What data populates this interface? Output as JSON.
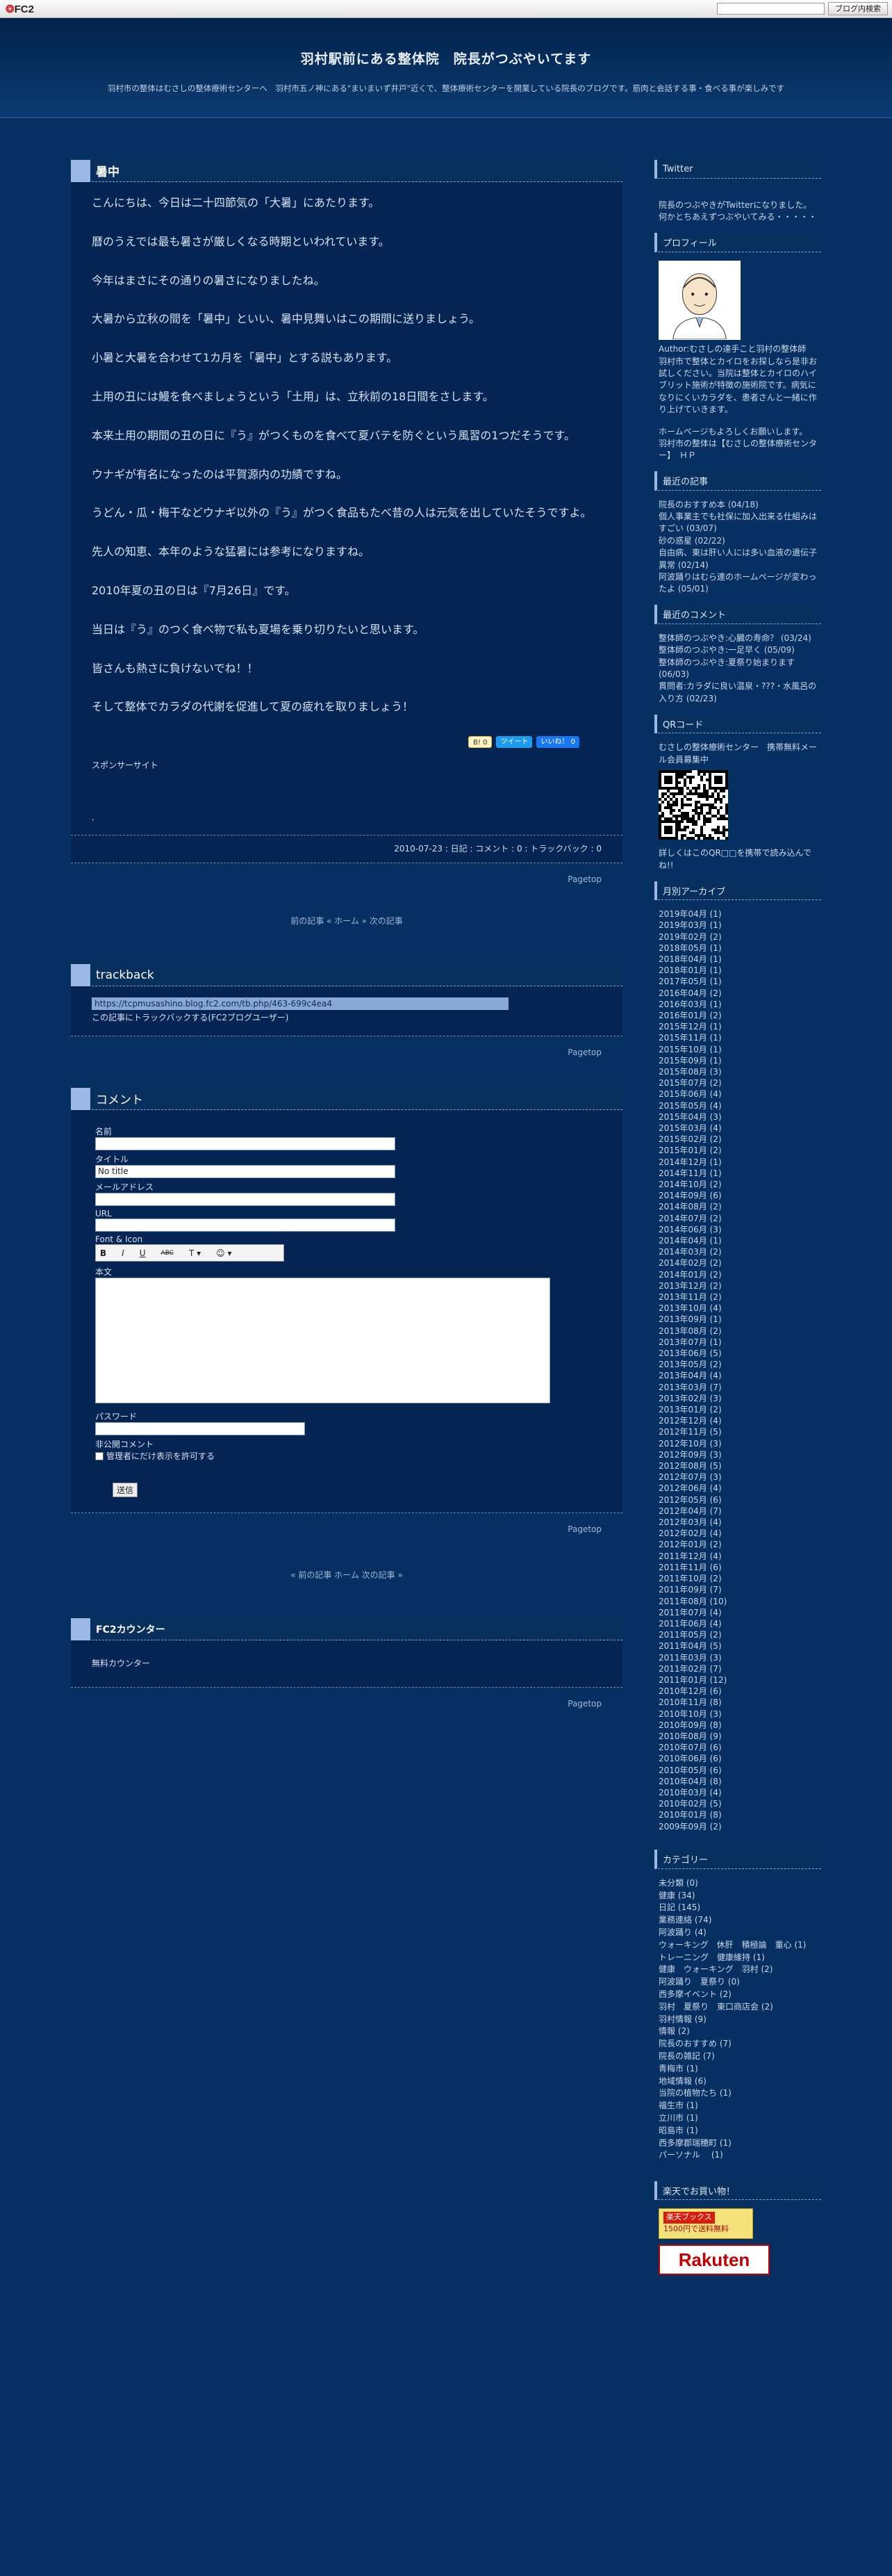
{
  "fc2bar": {
    "logo_a": "FC2",
    "search_button": "ブログ内検索"
  },
  "header": {
    "title": "羽村駅前にある整体院　院長がつぶやいてます",
    "description": "羽村市の整体はむさしの整体療術センターへ　羽村市五ノ神にある\"まいまいず井戸\"近くで、整体療術センターを開業している院長のブログです。筋肉と会話する事・食べる事が楽しみです"
  },
  "entry": {
    "title": "暑中",
    "paragraphs": [
      "こんにちは、今日は二十四節気の「大暑」にあたります。",
      "暦のうえでは最も暑さが厳しくなる時期といわれています。",
      "今年はまさにその通りの暑さになりましたね。",
      "大暑から立秋の間を「暑中」といい、暑中見舞いはこの期間に送りましょう。",
      "小暑と大暑を合わせて1カ月を「暑中」とする説もあります。",
      "土用の丑には鰻を食べましょうという「土用」は、立秋前の18日間をさします。",
      "本来土用の期間の丑の日に『う』がつくものを食べて夏バテを防ぐという風習の1つだそうです。",
      "ウナギが有名になったのは平賀源内の功績ですね。",
      "うどん・瓜・梅干などウナギ以外の『う』がつく食品もたべ昔の人は元気を出していたそうですよ。",
      "先人の知恵、本年のような猛暑には参考になりますね。",
      "2010年夏の丑の日は『7月26日』です。",
      "当日は『う』のつく食べ物で私も夏場を乗り切りたいと思います。",
      "皆さんも熱さに負けないでね！！",
      "そして整体でカラダの代謝を促進して夏の疲れを取りましょう！"
    ],
    "share_hatena": "B! 0",
    "share_tweet": "ツイート",
    "share_like": "いいね！ 0",
    "sponsor": "スポンサーサイト",
    "dot": ".",
    "footer": "2010-07-23 : 日記 : コメント : 0 : トラックバック : 0",
    "pagetop": "Pagetop"
  },
  "nav1": "前の記事 « ホーム » 次の記事",
  "trackback": {
    "title": "trackback",
    "url": "https://tcpmusashino.blog.fc2.com/tb.php/463-699c4ea4",
    "note": "この記事にトラックバックする(FC2ブログユーザー)",
    "pagetop": "Pagetop"
  },
  "comment": {
    "title": "コメント",
    "name_label": "名前",
    "title_label": "タイトル",
    "title_value": "No title",
    "mail_label": "メールアドレス",
    "url_label": "URL",
    "font_label": "Font & Icon",
    "tools": [
      "B",
      "I",
      "U",
      "ABC",
      "T ▾",
      "☺ ▾"
    ],
    "body_label": "本文",
    "pass_label": "パスワード",
    "secret_label": "非公開コメント",
    "secret_option": "管理者にだけ表示を許可する",
    "submit": "送信",
    "pagetop": "Pagetop"
  },
  "nav2": "« 前の記事  ホーム  次の記事 »",
  "counter": {
    "title": "FC2カウンター",
    "body": "無料カウンター",
    "pagetop": "Pagetop"
  },
  "side": {
    "twitter": {
      "title": "Twitter",
      "body": "院長のつぶやきがTwitterになりました。何かとちあえずつぶやいてみる・・・・・"
    },
    "profile": {
      "title": "プロフィール",
      "author": "Author:むさしの達手こと羽村の整体師",
      "body": "羽村市で整体とカイロをお探しなら是非お試しください。当院は整体とカイロのハイブリット施術が特徴の施術院です。病気になりにくいカラダを、患者さんと一緒に作り上げていきます。",
      "hp": "ホームページもよろしくお願いします。",
      "hp2": "羽村市の整体は【むさしの整体療術センター】　ＨＰ"
    },
    "recent": {
      "title": "最近の記事",
      "items": [
        "院長のおすすめ本 (04/18)",
        "個人事業主でも社保に加入出来る仕組みはすごい (03/07)",
        "砂の惑星 (02/22)",
        "自由病、東は肝い人には多い血液の遺伝子異常 (02/14)",
        "阿波踊りはむら連のホームページが変わったよ (05/01)"
      ]
    },
    "comments": {
      "title": "最近のコメント",
      "items": [
        "整体師のつぶやき:心臓の寿命？ (03/24)",
        "整体師のつぶやき:一足早く (05/09)",
        "整体師のつぶやき:夏祭り始まります (06/03)",
        "貫問者:カラダに良い温泉・???・水風呂の入り方 (02/23)"
      ]
    },
    "qr": {
      "title": "QRコード",
      "body": "むさしの整体療術センター　携帯無料メール会員募集中",
      "foot": "詳しくはこのQR□□を携帯で読み込んでね!!"
    },
    "archive": {
      "title": "月別アーカイブ",
      "items": [
        "2019年04月 (1)",
        "2019年03月 (1)",
        "2019年02月 (2)",
        "2018年05月 (1)",
        "2018年04月 (1)",
        "2018年01月 (1)",
        "2017年05月 (1)",
        "2016年04月 (2)",
        "2016年03月 (1)",
        "2016年01月 (2)",
        "2015年12月 (1)",
        "2015年11月 (1)",
        "2015年10月 (1)",
        "2015年09月 (1)",
        "2015年08月 (3)",
        "2015年07月 (2)",
        "2015年06月 (4)",
        "2015年05月 (4)",
        "2015年04月 (3)",
        "2015年03月 (4)",
        "2015年02月 (2)",
        "2015年01月 (2)",
        "2014年12月 (1)",
        "2014年11月 (1)",
        "2014年10月 (2)",
        "2014年09月 (6)",
        "2014年08月 (2)",
        "2014年07月 (2)",
        "2014年06月 (3)",
        "2014年04月 (1)",
        "2014年03月 (2)",
        "2014年02月 (2)",
        "2014年01月 (2)",
        "2013年12月 (2)",
        "2013年11月 (2)",
        "2013年10月 (4)",
        "2013年09月 (1)",
        "2013年08月 (2)",
        "2013年07月 (1)",
        "2013年06月 (5)",
        "2013年05月 (2)",
        "2013年04月 (4)",
        "2013年03月 (7)",
        "2013年02月 (3)",
        "2013年01月 (2)",
        "2012年12月 (4)",
        "2012年11月 (5)",
        "2012年10月 (3)",
        "2012年09月 (3)",
        "2012年08月 (5)",
        "2012年07月 (3)",
        "2012年06月 (4)",
        "2012年05月 (6)",
        "2012年04月 (7)",
        "2012年03月 (4)",
        "2012年02月 (4)",
        "2012年01月 (2)",
        "2011年12月 (4)",
        "2011年11月 (6)",
        "2011年10月 (2)",
        "2011年09月 (7)",
        "2011年08月 (10)",
        "2011年07月 (4)",
        "2011年06月 (4)",
        "2011年05月 (2)",
        "2011年04月 (5)",
        "2011年03月 (3)",
        "2011年02月 (7)",
        "2011年01月 (12)",
        "2010年12月 (6)",
        "2010年11月 (8)",
        "2010年10月 (3)",
        "2010年09月 (8)",
        "2010年08月 (9)",
        "2010年07月 (6)",
        "2010年06月 (6)",
        "2010年05月 (6)",
        "2010年04月 (8)",
        "2010年03月 (4)",
        "2010年02月 (5)",
        "2010年01月 (8)",
        "2009年09月 (2)"
      ]
    },
    "category": {
      "title": "カテゴリー",
      "items": [
        "未分類 (0)",
        "健康 (34)",
        "日記 (145)",
        "業務連絡 (74)",
        "阿波踊り (4)",
        "ウォーキング　休肝　積極論　重心 (1)",
        "トレーニング　健康維持 (1)",
        "健康　ウォーキング　羽村 (2)",
        "阿波踊り　夏祭り (0)",
        "西多摩イベント (2)",
        "羽村　夏祭り　東口商店会 (2)",
        "羽村情報 (9)",
        "情報 (2)",
        "院長のおすすめ (7)",
        "院長の雑記 (7)",
        "青梅市 (1)",
        "地域情報 (6)",
        "当院の植物たち (1)",
        "福生市 (1)",
        "立川市 (1)",
        "昭島市 (1)",
        "西多摩郡瑞穂町 (1)",
        "パーソナル　 (1)"
      ]
    },
    "rakuten": {
      "title": "楽天でお買い物！",
      "books1": "楽天ブックス",
      "books2": "1500円で送料無料",
      "logo": "Rakuten"
    }
  }
}
